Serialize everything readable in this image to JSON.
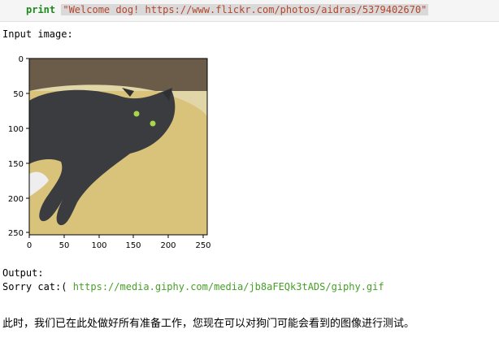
{
  "code_cell": {
    "keyword": "print",
    "string": "\"Welcome dog! https://www.flickr.com/photos/aidras/5379402670\""
  },
  "output": {
    "input_label": "Input image:",
    "output_label": "Output:",
    "sorry_prefix": "Sorry cat:( ",
    "sorry_link": "https://media.giphy.com/media/jb8aFEQk3tADS/giphy.gif",
    "chinese_text": "此时，我们已在此处做好所有准备工作，您现在可以对狗门可能会看到的图像进行测试。"
  },
  "image_plot": {
    "y_ticks": [
      "0",
      "50",
      "100",
      "150",
      "200",
      "250"
    ],
    "x_ticks": [
      "0",
      "50",
      "100",
      "150",
      "200",
      "250"
    ],
    "image_subject": "gray cat lying on yellow cushion",
    "colors": {
      "cushion": "#d9c27a",
      "cat": "#3a3c40",
      "eyes": "#a8d84a"
    }
  }
}
